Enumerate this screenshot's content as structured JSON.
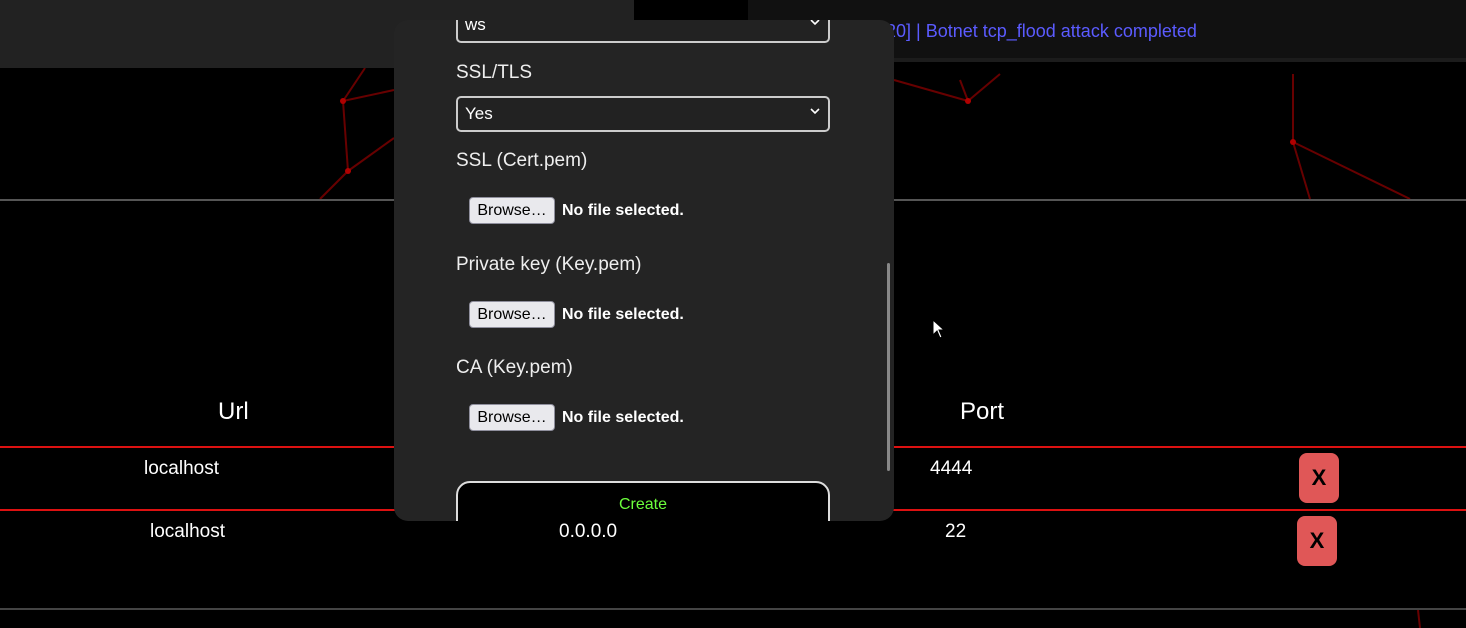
{
  "log": {
    "text": "20] | Botnet tcp_flood attack completed"
  },
  "table": {
    "headers": {
      "url": "Url",
      "port": "Port"
    },
    "rows": [
      {
        "url": "localhost",
        "ip": "",
        "port": "4444",
        "delete_label": "X"
      },
      {
        "url": "localhost",
        "ip": "0.0.0.0",
        "port": "22",
        "delete_label": "X"
      }
    ]
  },
  "modal": {
    "protocol_value": "ws",
    "ssl_tls": {
      "label": "SSL/TLS",
      "value": "Yes"
    },
    "cert": {
      "label": "SSL (Cert.pem)"
    },
    "key": {
      "label": "Private key (Key.pem)"
    },
    "ca": {
      "label": "CA (Key.pem)"
    },
    "browse_label": "Browse…",
    "no_file_text": "No file selected.",
    "create_label": "Create"
  },
  "colors": {
    "accent_red": "#dd1111",
    "delete_button": "#e05757",
    "log_text": "#5b5bff",
    "create_text": "#6cff3c"
  },
  "icons": [
    "chevron-down-icon",
    "mouse-cursor-icon"
  ]
}
